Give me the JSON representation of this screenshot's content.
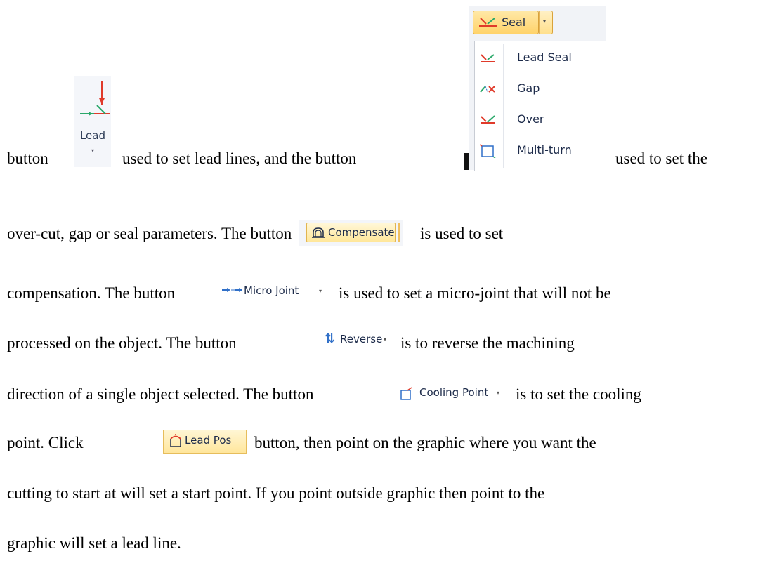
{
  "ribbon": {
    "lead": {
      "label": "Lead",
      "arrow": "▾",
      "icon": "lead-line-icon"
    },
    "seal": {
      "label": "Seal",
      "arrow": "▾",
      "icon": "seal-icon",
      "menu": [
        {
          "label": "Lead Seal",
          "icon": "lead-seal-icon"
        },
        {
          "label": "Gap",
          "icon": "gap-icon"
        },
        {
          "label": "Over",
          "icon": "over-icon"
        },
        {
          "label": "Multi-turn",
          "icon": "multi-turn-icon"
        }
      ]
    },
    "compensate": {
      "label": "Compensate",
      "icon": "compensate-icon"
    },
    "micro_joint": {
      "label": "Micro Joint",
      "arrow": "▾",
      "icon": "micro-joint-icon"
    },
    "reverse": {
      "label": "Reverse",
      "arrow": "▾",
      "icon": "reverse-icon",
      "glyph": "⇅"
    },
    "cooling_point": {
      "label": "Cooling Point",
      "arrow": "▾",
      "icon": "cooling-point-icon"
    },
    "lead_pos": {
      "label": "Lead Pos",
      "icon": "lead-pos-icon"
    }
  },
  "text": {
    "l1a": "button",
    "l1b": "used to set lead lines, and the button",
    "l1c": "used to set the",
    "l2a": "over-cut, gap or seal parameters. The button",
    "l2b": "is used to set",
    "l3a": "compensation. The button",
    "l3b": "is used to set a micro-joint that will not be",
    "l4a": "processed on the object. The button",
    "l4b": "is to reverse the machining",
    "l5a": "direction of a single object selected. The button",
    "l5b": "is to set the cooling",
    "l6a": "point. Click",
    "l6b": "button, then point on the graphic where you want the",
    "l7": "cutting to start at will set a start point. If you point outside graphic then point to the",
    "l8": "graphic will set a lead line."
  },
  "colors": {
    "accent_yellow": "#ffd36b",
    "icon_red": "#e03a2a",
    "icon_green": "#2aa86a",
    "icon_blue": "#2f6fc8"
  }
}
